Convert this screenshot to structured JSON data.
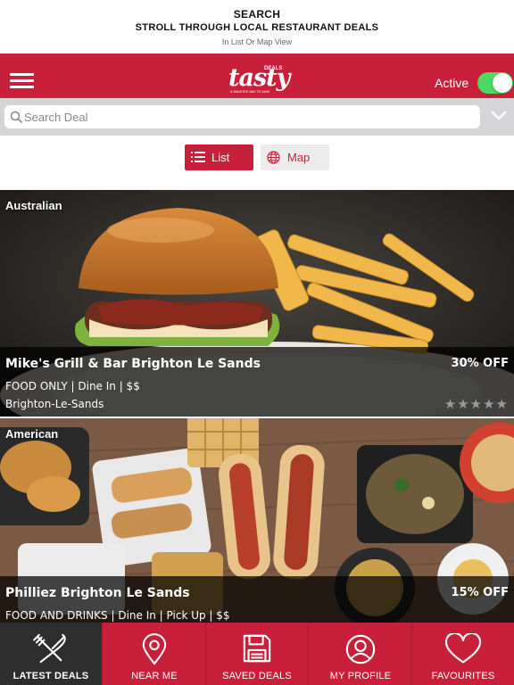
{
  "promo": {
    "title": "SEARCH",
    "subtitle": "STROLL THROUGH LOCAL RESTAURANT DEALS",
    "note": "In List Or Map View"
  },
  "appbar": {
    "logo_text": "tasty",
    "logo_sup": "DEALS",
    "logo_tagline": "A SMARTER WAY TO SAVE",
    "active_label": "Active",
    "active_on": true,
    "color": "#c8203a"
  },
  "search": {
    "placeholder": "Search Deal",
    "value": ""
  },
  "view": {
    "list_label": "List",
    "map_label": "Map",
    "selected": "List"
  },
  "deals": [
    {
      "category": "Australian",
      "name": "Mike's Grill & Bar Brighton Le Sands",
      "discount": "30% OFF",
      "meta": "FOOD ONLY | Dine In | $$",
      "location": "Brighton-Le-Sands",
      "stars": "★★★★★"
    },
    {
      "category": "American",
      "name": "Philliez Brighton Le Sands",
      "discount": "15% OFF",
      "meta": "FOOD AND DRINKS | Dine In | Pick Up | $$"
    }
  ],
  "tabs": [
    {
      "label": "LATEST DEALS",
      "icon": "fork-knife-icon"
    },
    {
      "label": "NEAR ME",
      "icon": "location-pin-icon"
    },
    {
      "label": "SAVED DEALS",
      "icon": "floppy-disk-icon"
    },
    {
      "label": "MY PROFILE",
      "icon": "user-icon"
    },
    {
      "label": "FAVOURITES",
      "icon": "heart-icon"
    }
  ],
  "active_tab": "LATEST DEALS"
}
